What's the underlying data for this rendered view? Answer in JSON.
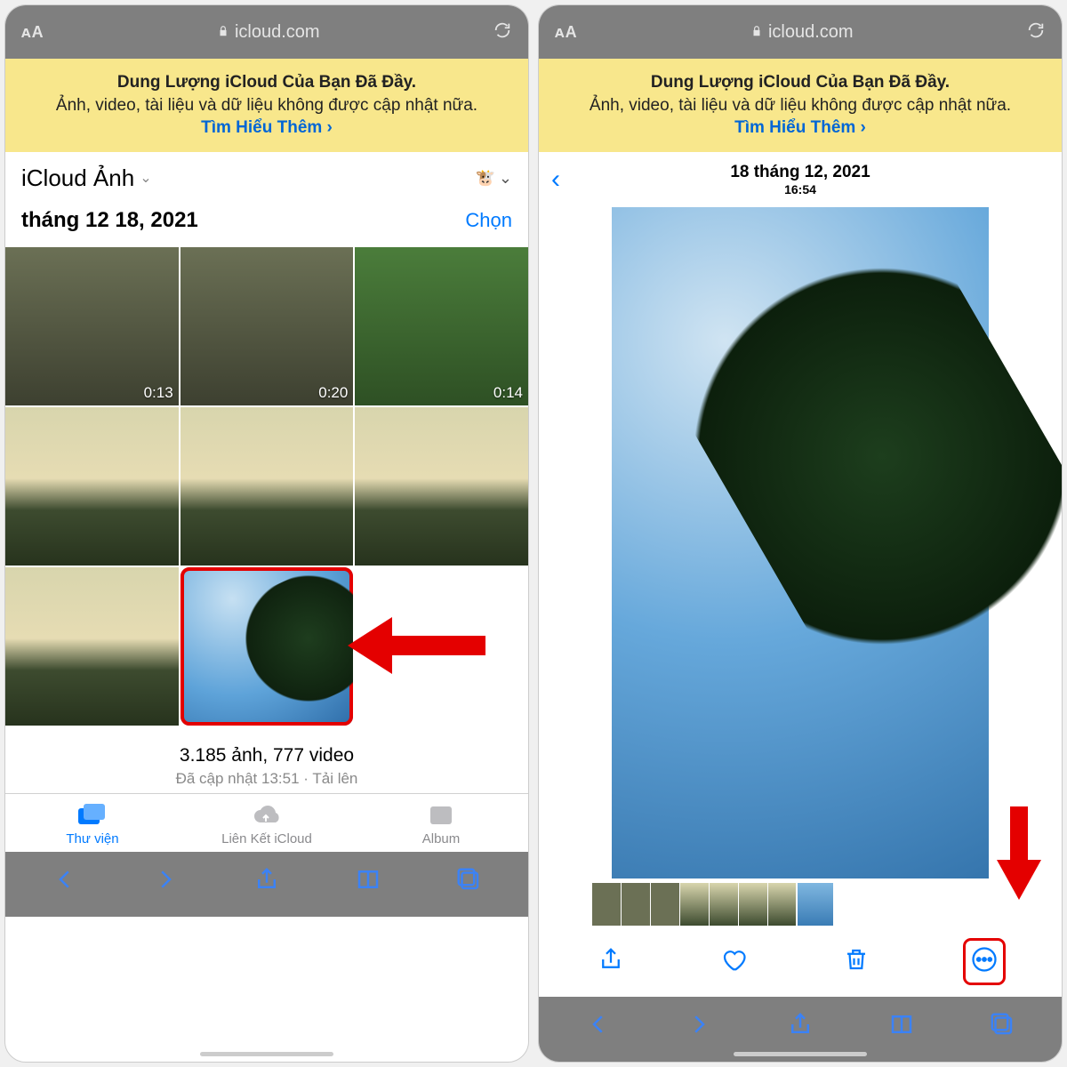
{
  "addressbar": {
    "aa_label": "ᴀA",
    "url": "icloud.com"
  },
  "banner": {
    "title": "Dung Lượng iCloud Của Bạn Đã Đầy.",
    "body": "Ảnh, video, tài liệu và dữ liệu không được cập nhật nữa.",
    "link": "Tìm Hiểu Thêm ›"
  },
  "left": {
    "library_title": "iCloud Ảnh",
    "account_emoji": "🐮",
    "date_label": "tháng 12 18, 2021",
    "select_label": "Chọn",
    "durations": [
      "0:13",
      "0:20",
      "0:14"
    ],
    "footer_count": "3.185 ảnh, 777 video",
    "footer_sub_updated": "Đã cập nhật 13:51",
    "footer_sub_upload": "Tải lên",
    "tabs": {
      "library": "Thư viện",
      "links": "Liên Kết iCloud",
      "album": "Album"
    }
  },
  "right": {
    "detail_date": "18 tháng 12, 2021",
    "detail_time": "16:54"
  }
}
